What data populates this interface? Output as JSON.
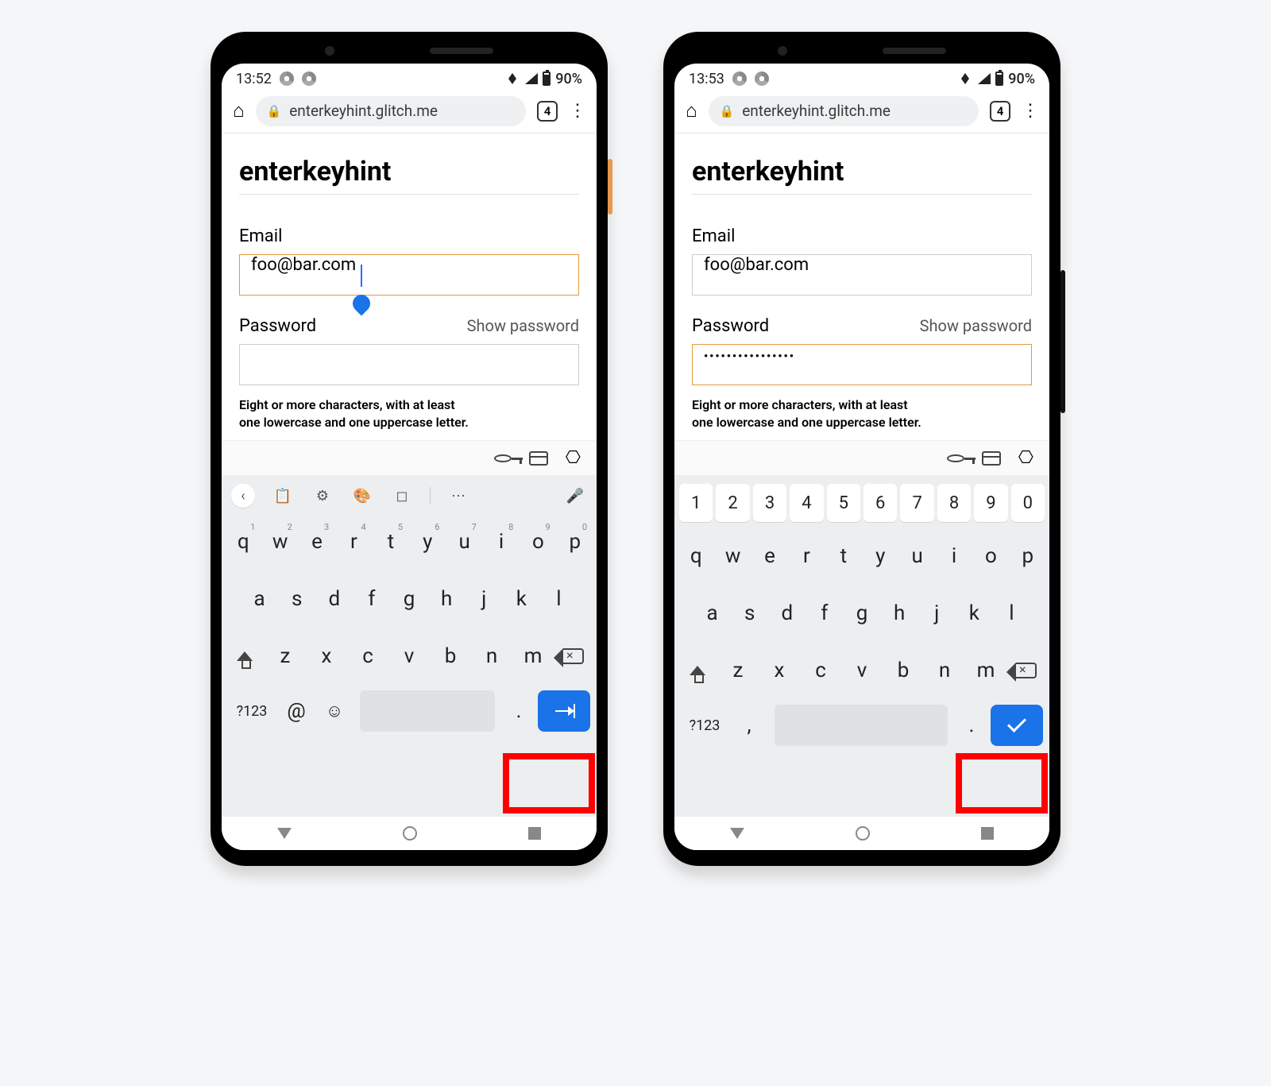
{
  "phones": [
    {
      "status": {
        "time": "13:52",
        "battery": "90%"
      },
      "browser": {
        "url": "enterkeyhint.glitch.me",
        "tab_count": "4"
      },
      "page_title": "enterkeyhint",
      "form": {
        "email_label": "Email",
        "email_value": "foo@bar.com",
        "password_label": "Password",
        "show_password_label": "Show password",
        "password_value": "",
        "password_hint_l1": "Eight or more characters, with at least",
        "password_hint_l2": "one lowercase and one uppercase letter.",
        "focused": "email",
        "enter_key": "next"
      },
      "keyboard": {
        "mode": "email",
        "sym_label": "?123",
        "at_label": "@",
        "comma_label": ",",
        "dot_label": "."
      }
    },
    {
      "status": {
        "time": "13:53",
        "battery": "90%"
      },
      "browser": {
        "url": "enterkeyhint.glitch.me",
        "tab_count": "4"
      },
      "page_title": "enterkeyhint",
      "form": {
        "email_label": "Email",
        "email_value": "foo@bar.com",
        "password_label": "Password",
        "show_password_label": "Show password",
        "password_value": "••••••••••••••••",
        "password_hint_l1": "Eight or more characters, with at least",
        "password_hint_l2": "one lowercase and one uppercase letter.",
        "focused": "password",
        "enter_key": "done"
      },
      "keyboard": {
        "mode": "password",
        "sym_label": "?123",
        "at_label": "@",
        "comma_label": ",",
        "dot_label": "."
      }
    }
  ],
  "keys": {
    "num_row": [
      "1",
      "2",
      "3",
      "4",
      "5",
      "6",
      "7",
      "8",
      "9",
      "0"
    ],
    "row1": [
      "q",
      "w",
      "e",
      "r",
      "t",
      "y",
      "u",
      "i",
      "o",
      "p"
    ],
    "row1_sup": [
      "1",
      "2",
      "3",
      "4",
      "5",
      "6",
      "7",
      "8",
      "9",
      "0"
    ],
    "row2": [
      "a",
      "s",
      "d",
      "f",
      "g",
      "h",
      "j",
      "k",
      "l"
    ],
    "row3": [
      "z",
      "x",
      "c",
      "v",
      "b",
      "n",
      "m"
    ]
  }
}
